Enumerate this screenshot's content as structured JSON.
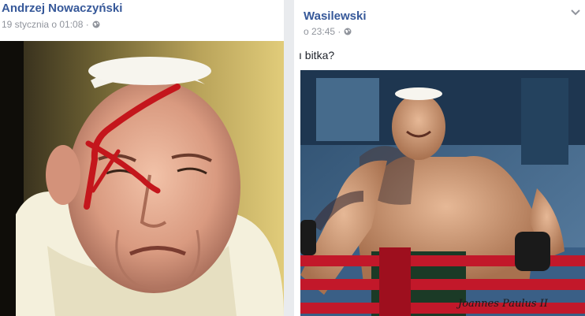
{
  "left_post": {
    "author": "Andrzej Nowaczyński",
    "timestamp": "19 stycznia o 01:08 ·",
    "privacy_icon": "globe-icon",
    "photo_description_icon": "photo"
  },
  "right_post": {
    "author": "Wasilewski",
    "timestamp": "o 23:45 ·",
    "privacy_icon": "globe-icon",
    "text": "ı bitka?",
    "menu_icon": "chevron-down-icon",
    "photo_signature": "Joannes Paulus II"
  },
  "colors": {
    "link_blue": "#365899",
    "meta_grey": "#90949c",
    "text": "#1d2129",
    "feed_bg": "#e9ebee"
  }
}
